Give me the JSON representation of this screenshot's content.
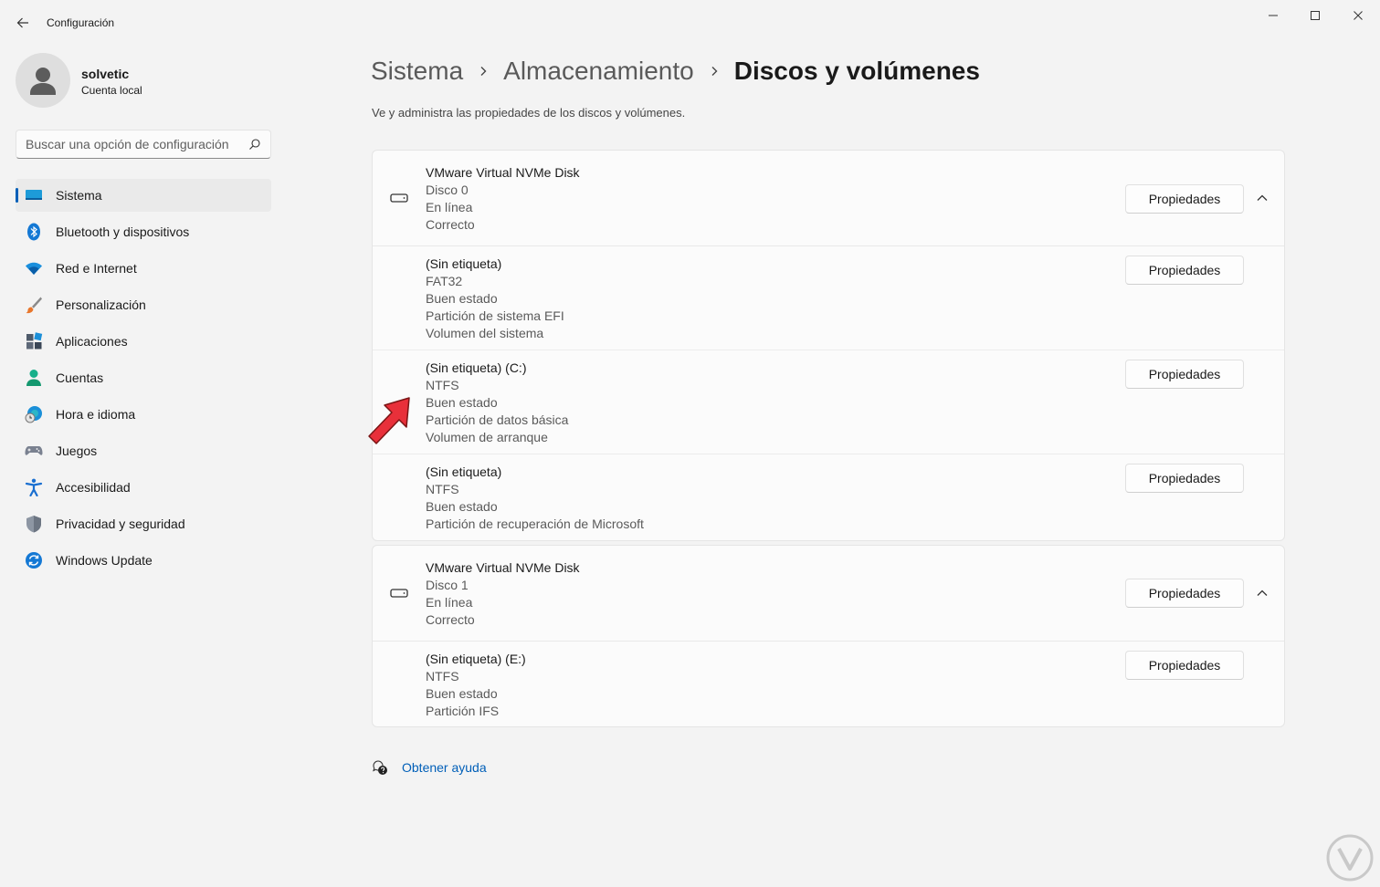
{
  "window": {
    "title": "Configuración",
    "minimize_symbol": "—",
    "maximize_symbol": "☐",
    "close_symbol": "✕"
  },
  "user": {
    "name": "solvetic",
    "account_type": "Cuenta local"
  },
  "search": {
    "placeholder": "Buscar una opción de configuración"
  },
  "sidebar": {
    "items": [
      {
        "label": "Sistema",
        "icon": "monitor-icon",
        "active": true
      },
      {
        "label": "Bluetooth y dispositivos",
        "icon": "bluetooth-icon"
      },
      {
        "label": "Red e Internet",
        "icon": "wifi-icon"
      },
      {
        "label": "Personalización",
        "icon": "brush-icon"
      },
      {
        "label": "Aplicaciones",
        "icon": "apps-icon"
      },
      {
        "label": "Cuentas",
        "icon": "person-icon"
      },
      {
        "label": "Hora e idioma",
        "icon": "globe-clock-icon"
      },
      {
        "label": "Juegos",
        "icon": "gamepad-icon"
      },
      {
        "label": "Accesibilidad",
        "icon": "accessibility-icon"
      },
      {
        "label": "Privacidad y seguridad",
        "icon": "shield-icon"
      },
      {
        "label": "Windows Update",
        "icon": "update-icon"
      }
    ]
  },
  "breadcrumb": {
    "items": [
      "Sistema",
      "Almacenamiento",
      "Discos y volúmenes"
    ]
  },
  "page": {
    "description": "Ve y administra las propiedades de los discos y volúmenes."
  },
  "properties_label": "Propiedades",
  "disks": [
    {
      "header": [
        "VMware Virtual NVMe Disk",
        "Disco 0",
        "En línea",
        "Correcto"
      ],
      "volumes": [
        [
          "(Sin etiqueta)",
          "FAT32",
          "Buen estado",
          "Partición de sistema EFI",
          "Volumen del sistema"
        ],
        [
          "(Sin etiqueta) (C:)",
          "NTFS",
          "Buen estado",
          "Partición de datos básica",
          "Volumen de arranque"
        ],
        [
          "(Sin etiqueta)",
          "NTFS",
          "Buen estado",
          "Partición de recuperación de Microsoft"
        ]
      ]
    },
    {
      "header": [
        "VMware Virtual NVMe Disk",
        "Disco 1",
        "En línea",
        "Correcto"
      ],
      "volumes": [
        [
          "(Sin etiqueta) (E:)",
          "NTFS",
          "Buen estado",
          "Partición IFS"
        ]
      ]
    }
  ],
  "help": {
    "label": "Obtener ayuda"
  },
  "colors": {
    "accent": "#005fb8",
    "annotation_arrow": "#e8303a",
    "window_background": "#f3f3f3"
  }
}
